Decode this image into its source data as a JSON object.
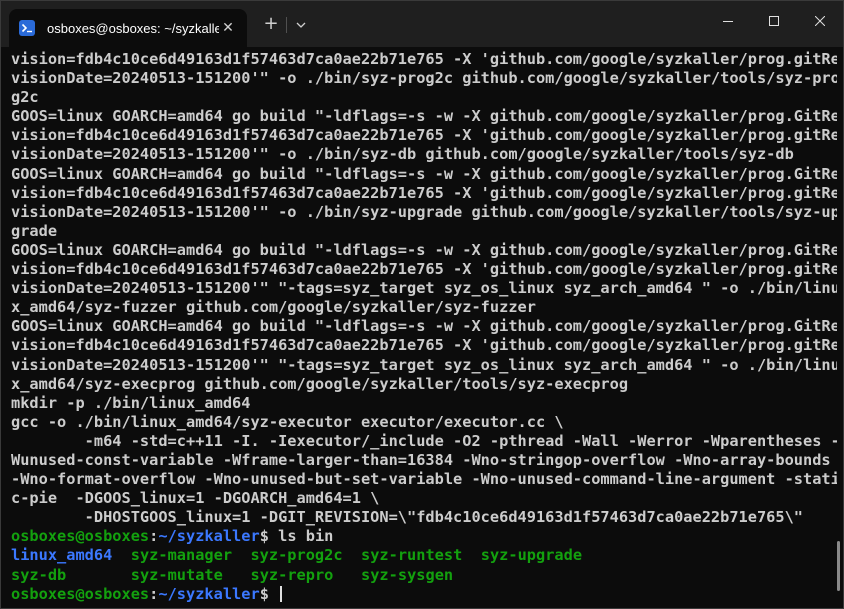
{
  "window": {
    "tab_title": "osboxes@osboxes: ~/syzkaller",
    "tab_icon": "terminal-icon",
    "new_tab": "+"
  },
  "output_lines": [
    "vision=fdb4c10ce6d49163d1f57463d7ca0ae22b71e765 -X 'github.com/google/syzkaller/prog.gitRe",
    "visionDate=20240513-151200'\" -o ./bin/syz-prog2c github.com/google/syzkaller/tools/syz-pro",
    "g2c",
    "GOOS=linux GOARCH=amd64 go build \"-ldflags=-s -w -X github.com/google/syzkaller/prog.GitRe",
    "vision=fdb4c10ce6d49163d1f57463d7ca0ae22b71e765 -X 'github.com/google/syzkaller/prog.gitRe",
    "visionDate=20240513-151200'\" -o ./bin/syz-db github.com/google/syzkaller/tools/syz-db",
    "GOOS=linux GOARCH=amd64 go build \"-ldflags=-s -w -X github.com/google/syzkaller/prog.GitRe",
    "vision=fdb4c10ce6d49163d1f57463d7ca0ae22b71e765 -X 'github.com/google/syzkaller/prog.gitRe",
    "visionDate=20240513-151200'\" -o ./bin/syz-upgrade github.com/google/syzkaller/tools/syz-up",
    "grade",
    "GOOS=linux GOARCH=amd64 go build \"-ldflags=-s -w -X github.com/google/syzkaller/prog.GitRe",
    "vision=fdb4c10ce6d49163d1f57463d7ca0ae22b71e765 -X 'github.com/google/syzkaller/prog.gitRe",
    "visionDate=20240513-151200'\" \"-tags=syz_target syz_os_linux syz_arch_amd64 \" -o ./bin/linu",
    "x_amd64/syz-fuzzer github.com/google/syzkaller/syz-fuzzer",
    "GOOS=linux GOARCH=amd64 go build \"-ldflags=-s -w -X github.com/google/syzkaller/prog.GitRe",
    "vision=fdb4c10ce6d49163d1f57463d7ca0ae22b71e765 -X 'github.com/google/syzkaller/prog.gitRe",
    "visionDate=20240513-151200'\" \"-tags=syz_target syz_os_linux syz_arch_amd64 \" -o ./bin/linu",
    "x_amd64/syz-execprog github.com/google/syzkaller/tools/syz-execprog",
    "mkdir -p ./bin/linux_amd64",
    "gcc -o ./bin/linux_amd64/syz-executor executor/executor.cc \\",
    "        -m64 -std=c++11 -I. -Iexecutor/_include -O2 -pthread -Wall -Werror -Wparentheses -",
    "Wunused-const-variable -Wframe-larger-than=16384 -Wno-stringop-overflow -Wno-array-bounds",
    "-Wno-format-overflow -Wno-unused-but-set-variable -Wno-unused-command-line-argument -stati",
    "c-pie  -DGOOS_linux=1 -DGOARCH_amd64=1 \\",
    "        -DHOSTGOOS_linux=1 -DGIT_REVISION=\\\"fdb4c10ce6d49163d1f57463d7ca0ae22b71e765\\\""
  ],
  "prompt": {
    "user": "osboxes@osboxes",
    "sep": ":",
    "path": "~/syzkaller",
    "symbol": "$ ",
    "command": "ls bin"
  },
  "ls_output": {
    "row1": [
      {
        "name": "linux_amd64",
        "kind": "dir",
        "pad": "  "
      },
      {
        "name": "syz-manager",
        "kind": "exe",
        "pad": "  "
      },
      {
        "name": "syz-prog2c",
        "kind": "exe",
        "pad": "  "
      },
      {
        "name": "syz-runtest",
        "kind": "exe",
        "pad": "  "
      },
      {
        "name": "syz-upgrade",
        "kind": "exe",
        "pad": ""
      }
    ],
    "row2": [
      {
        "name": "syz-db",
        "kind": "exe",
        "pad": "       "
      },
      {
        "name": "syz-mutate",
        "kind": "exe",
        "pad": "   "
      },
      {
        "name": "syz-repro",
        "kind": "exe",
        "pad": "   "
      },
      {
        "name": "syz-sysgen",
        "kind": "exe",
        "pad": ""
      }
    ]
  },
  "colors": {
    "background": "#0c0c0c",
    "text": "#cccccc",
    "prompt_user": "#13a10e",
    "prompt_path": "#3b78ff",
    "directory": "#3b78ff",
    "executable": "#13a10e"
  }
}
